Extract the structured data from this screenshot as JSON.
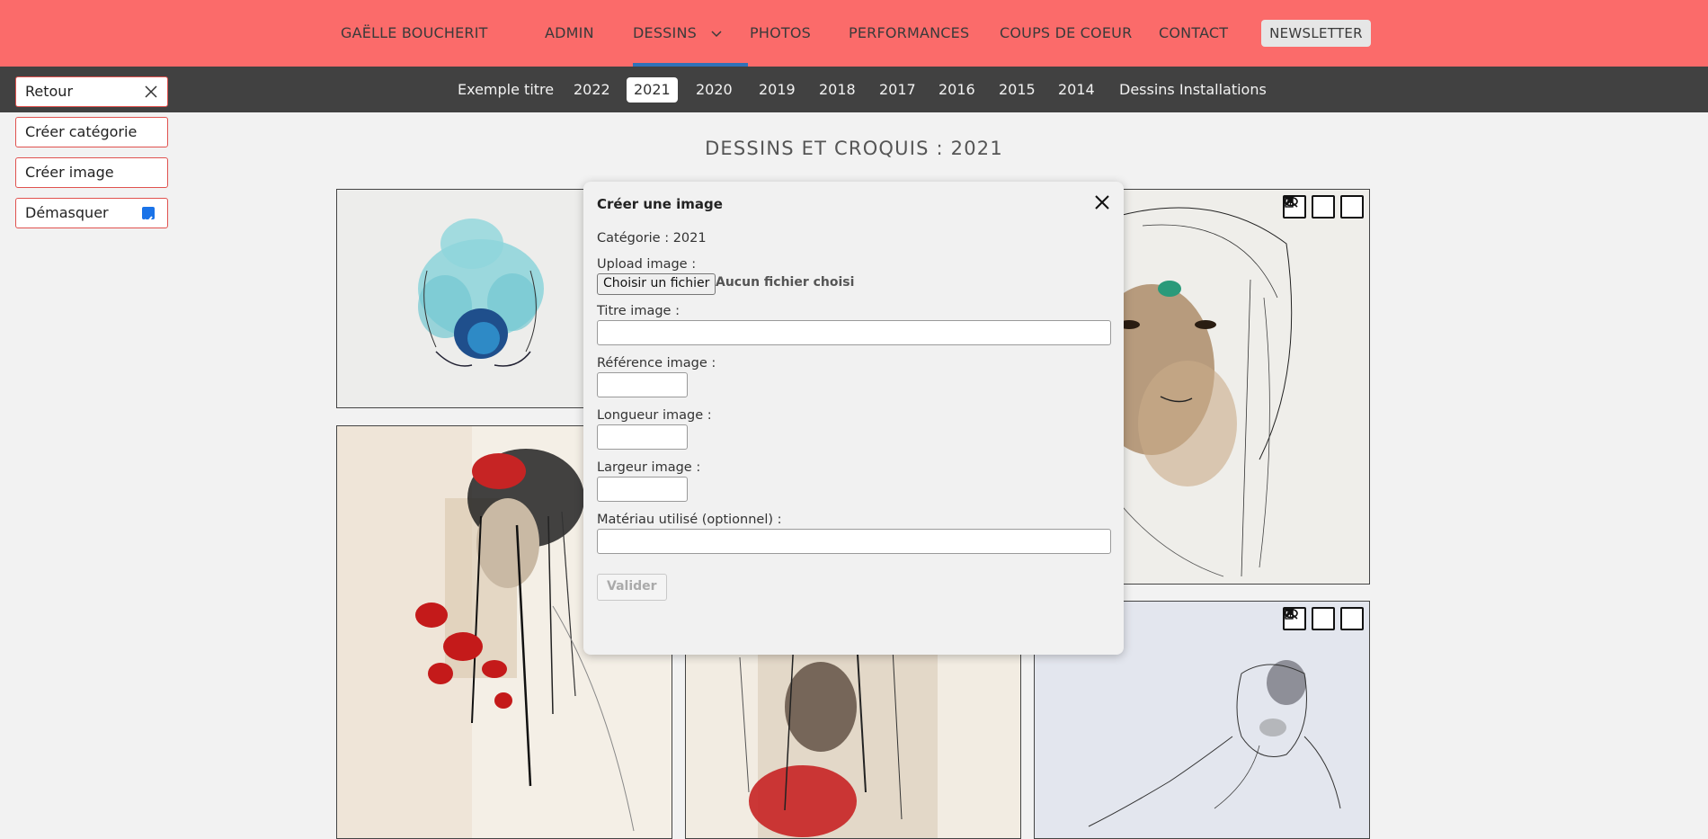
{
  "topnav": {
    "brand": "GAËLLE BOUCHERIT",
    "items": [
      "ADMIN",
      "DESSINS",
      "PHOTOS",
      "PERFORMANCES",
      "COUPS DE COEUR",
      "CONTACT"
    ],
    "newsletter": "NEWSLETTER",
    "bg_color": "#fb6b6a",
    "active_underline_color": "#2f72b8"
  },
  "subnav": {
    "categories": [
      "Exemple titre",
      "2022",
      "2021",
      "2020",
      "2019",
      "2018",
      "2017",
      "2016",
      "2015",
      "2014",
      "Dessins Installations"
    ],
    "active": "2021",
    "bg_color": "#414141"
  },
  "admin": {
    "retour": "Retour",
    "creer_categorie": "Créer catégorie",
    "creer_image": "Créer image",
    "demasquer": "Démasquer",
    "demasquer_checked": true
  },
  "page": {
    "title": "DESSINS ET CROQUIS : 2021"
  },
  "gallery": {
    "tool_icons": [
      "eye-slash-icon",
      "pencil-icon",
      "trash-icon"
    ]
  },
  "modal": {
    "title": "Créer une image",
    "categorie": "Catégorie : 2021",
    "upload_label": "Upload image :",
    "file_button": "Choisir un fichier",
    "file_status": "Aucun fichier choisi",
    "titre_label": "Titre image :",
    "titre_value": "",
    "reference_label": "Référence image :",
    "reference_value": "",
    "longueur_label": "Longueur image :",
    "longueur_value": "",
    "largeur_label": "Largeur image :",
    "largeur_value": "",
    "materiau_label": "Matériau utilisé (optionnel) :",
    "materiau_value": "",
    "submit": "Valider"
  }
}
